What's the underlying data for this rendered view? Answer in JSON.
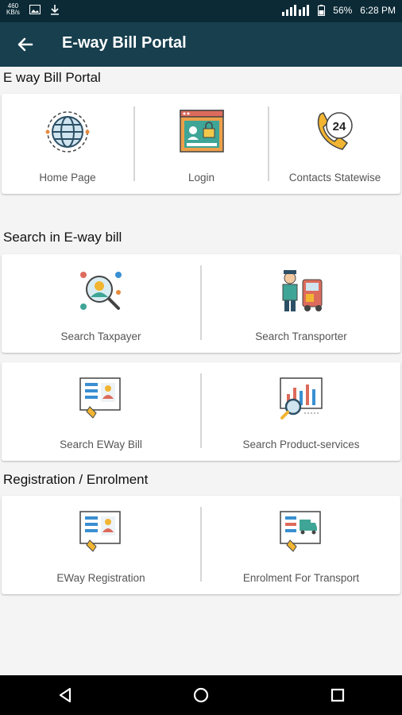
{
  "status": {
    "net_value": "460",
    "net_unit": "KB/s",
    "battery": "56%",
    "time": "6:28 PM"
  },
  "appbar": {
    "title": "E-way Bill Portal"
  },
  "sections": {
    "portal": {
      "title": "E way Bill Portal",
      "items": [
        "Home Page",
        "Login",
        "Contacts Statewise"
      ]
    },
    "search": {
      "title": "Search in E-way bill",
      "items": [
        "Search Taxpayer",
        "Search Transporter",
        "Search EWay Bill",
        "Search Product-services"
      ]
    },
    "registration": {
      "title": "Registration / Enrolment",
      "items": [
        "EWay Registration",
        "Enrolment For Transport"
      ]
    }
  },
  "colors": {
    "statusbar": "#0b2a36",
    "appbar": "#173f4e",
    "accent_yellow": "#f2b532",
    "accent_orange": "#e88a3c"
  }
}
